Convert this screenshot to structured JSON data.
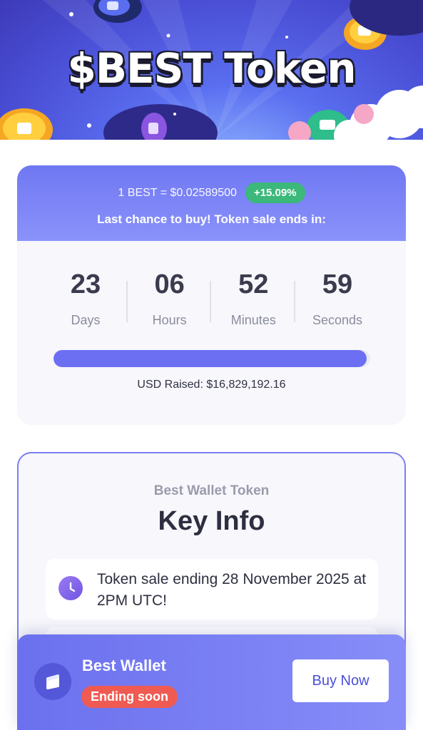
{
  "hero": {
    "title": "$BEST Token"
  },
  "sale": {
    "price_text": "1 BEST  = $0.02589500",
    "change_badge": "+15.09%",
    "ends_text": "Last chance to buy! Token sale ends in:",
    "countdown": [
      {
        "value": "23",
        "label": "Days"
      },
      {
        "value": "06",
        "label": "Hours"
      },
      {
        "value": "52",
        "label": "Minutes"
      },
      {
        "value": "59",
        "label": "Seconds"
      }
    ],
    "progress_fraction": 0.99,
    "raised_text": "USD Raised: $16,829,192.16"
  },
  "key_info": {
    "subtitle": "Best Wallet Token",
    "title": "Key Info",
    "items": [
      {
        "icon": "clock-icon",
        "text": "Token sale ending 28 November 2025 at 2PM UTC!"
      }
    ]
  },
  "sticky_bar": {
    "name": "Best Wallet",
    "badge": "Ending soon",
    "button": "Buy Now"
  },
  "colors": {
    "accent": "#6c6ff2",
    "positive": "#3bb87a",
    "warning": "#ef5b52"
  }
}
